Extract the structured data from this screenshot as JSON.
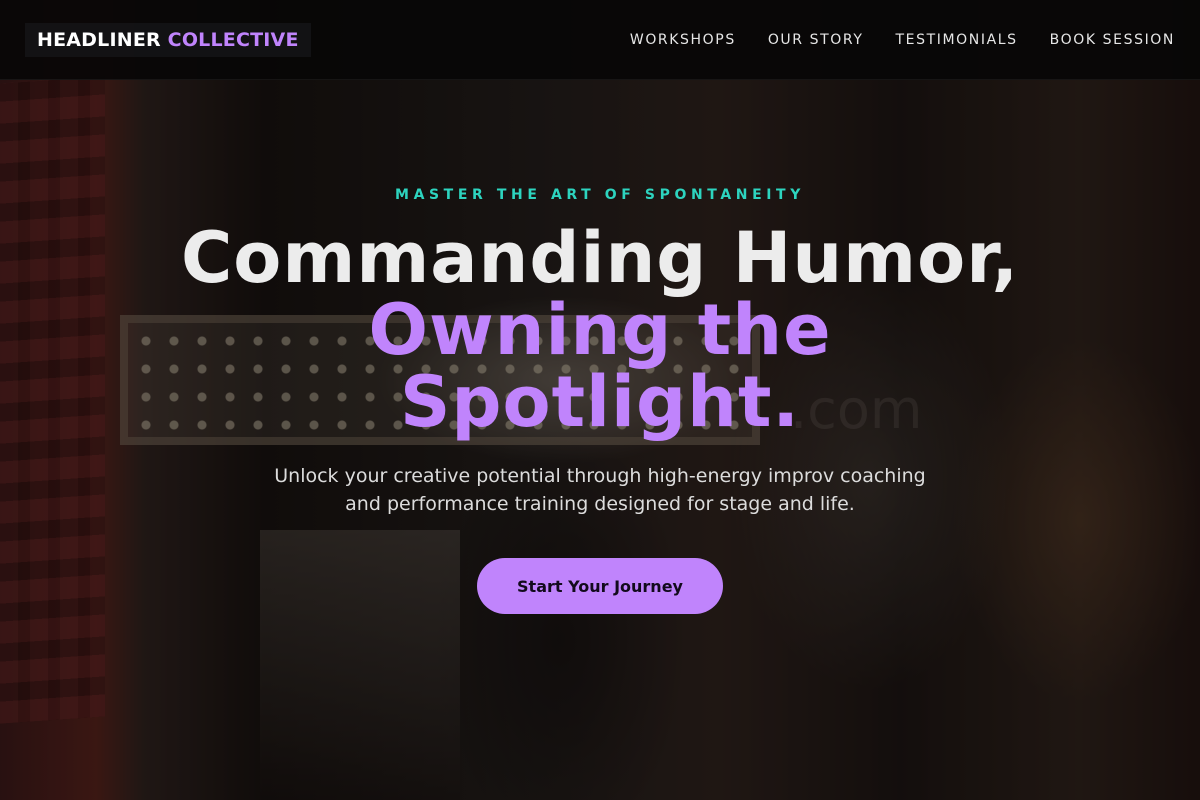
{
  "brand": {
    "part1": "HEADLINER",
    "part2": "COLLECTIVE"
  },
  "nav": {
    "items": [
      {
        "label": "WORKSHOPS"
      },
      {
        "label": "OUR STORY"
      },
      {
        "label": "TESTIMONIALS"
      },
      {
        "label": "BOOK SESSION"
      }
    ]
  },
  "hero": {
    "eyebrow": "MASTER THE ART OF SPONTANEITY",
    "headline_line1": "Commanding Humor,",
    "headline_accent_line1": "Owning the",
    "headline_accent_line2": "Spotlight.",
    "subtitle": "Unlock your creative potential through high-energy improv coaching and performance training designed for stage and life.",
    "cta_label": "Start Your Journey",
    "background_sign_text": ".com"
  },
  "colors": {
    "accent_purple": "#c084fc",
    "accent_teal": "#2dd4bf",
    "nav_bg": "#080606"
  }
}
